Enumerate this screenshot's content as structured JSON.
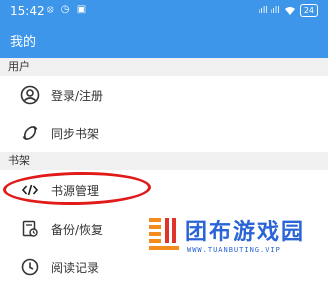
{
  "status_bar": {
    "time": "15:42",
    "left_icons": "⦻ ◷ ▣",
    "signal": "ᵢıll ᵢıll",
    "battery": "24"
  },
  "app": {
    "title": "我的"
  },
  "sections": [
    {
      "header": "用户",
      "items": [
        {
          "label": "登录/注册",
          "icon": "user-circle-icon"
        },
        {
          "label": "同步书架",
          "icon": "sync-icon"
        }
      ]
    },
    {
      "header": "书架",
      "items": [
        {
          "label": "书源管理",
          "icon": "code-icon"
        },
        {
          "label": "备份/恢复",
          "icon": "backup-icon"
        },
        {
          "label": "阅读记录",
          "icon": "clock-icon"
        }
      ]
    }
  ],
  "watermark": {
    "title": "团布游戏园",
    "url": "WWW.TUANBUTING.VIP"
  },
  "colors": {
    "appbar": "#3d96ea",
    "highlight": "#e11a1a",
    "watermark": "#2a64d6"
  }
}
